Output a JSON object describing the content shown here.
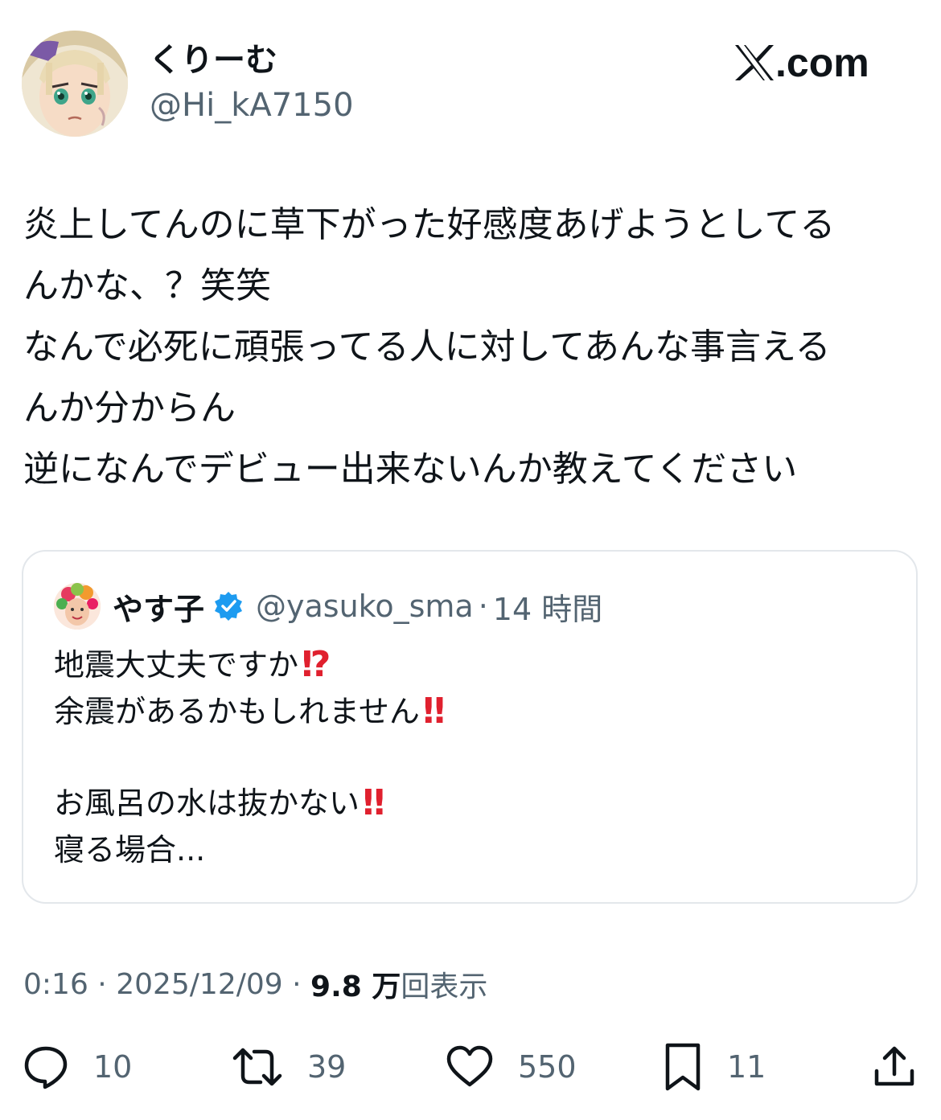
{
  "author": {
    "display_name": "くりーむ",
    "handle": "@Hi_kA7150"
  },
  "brand": {
    "site": ".com"
  },
  "tweet": {
    "lines": [
      "炎上してんのに草下がった好感度あげようとしてる",
      "んかな、？笑笑",
      "なんで必死に頑張ってる人に対してあんな事言える",
      "んか分からん",
      "逆になんでデビュー出来ないんか教えてください"
    ]
  },
  "quote": {
    "display_name": "やす子",
    "handle": "@yasuko_sma",
    "separator": "·",
    "time": "14 時間",
    "line1": "地震大丈夫ですか",
    "line1_emoji": "⁉",
    "line2": "余震があるかもしれません",
    "line2_emoji": "‼",
    "line3": "お風呂の水は抜かない",
    "line3_emoji": "‼",
    "line4": "寝る場合..."
  },
  "meta": {
    "time": "0:16",
    "sep1": " · ",
    "date": "2025/12/09",
    "sep2": " · ",
    "views_number": "9.8 万",
    "views_label": "回表示"
  },
  "actions": {
    "replies": "10",
    "retweets": "39",
    "likes": "550",
    "bookmarks": "11"
  },
  "colors": {
    "text": "#0f1419",
    "secondary": "#536471",
    "verified": "#1d9bf0",
    "emoji_red": "#e0202e",
    "border": "#e3e7eb"
  }
}
